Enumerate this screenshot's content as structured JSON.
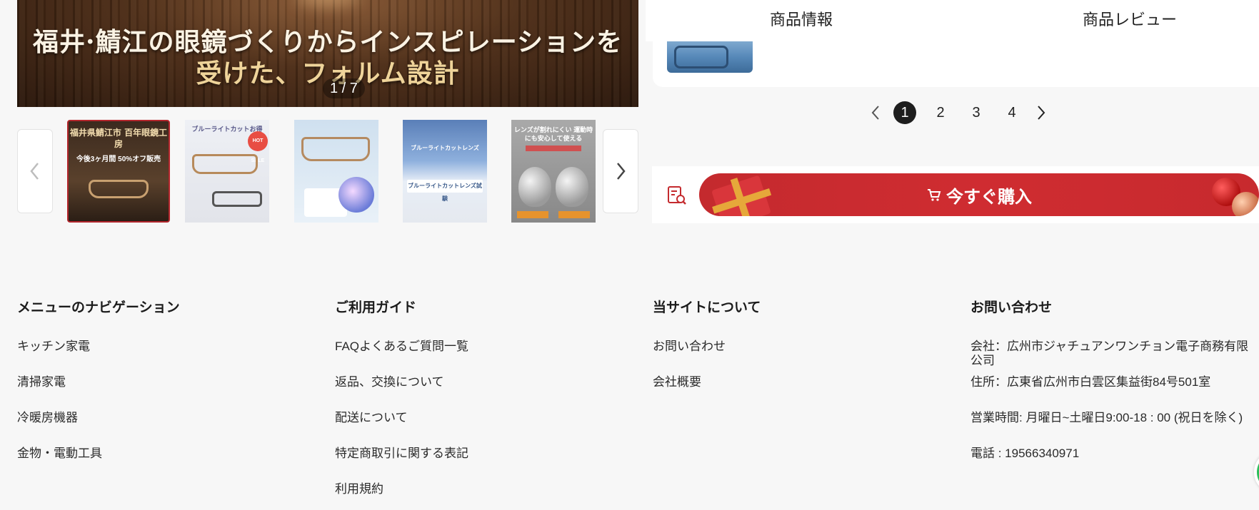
{
  "hero": {
    "line1": "福井·鯖江の眼鏡づくりからインスピレーションを",
    "line2": "受けた、フォルム設計",
    "counter": "1 / 7"
  },
  "thumbnails": {
    "t1_title": "福井県鯖江市 百年眼鏡工房",
    "t1_sub": "今後3ヶ月間 50%オフ販売",
    "t2_title": "ブルーライトカットお得",
    "t2_badge": "HOT SALE",
    "t4_title": "ブルーライトカットレンズ",
    "t4_box": "ブルーライトカットレンズ試験",
    "t5_title": "レンズが割れにくい 運動時にも安心して使える"
  },
  "tabs": {
    "info": "商品情報",
    "review": "商品レビュー"
  },
  "pagination": {
    "pages": [
      "1",
      "2",
      "3",
      "4"
    ],
    "current": "1"
  },
  "buy": {
    "label": "今すぐ購入"
  },
  "footer": {
    "nav": {
      "title": "メニューのナビゲーション",
      "items": [
        "キッチン家電",
        "清掃家電",
        "冷暖房機器",
        "金物・電動工具"
      ]
    },
    "guide": {
      "title": "ご利用ガイド",
      "items": [
        "FAQよくあるご質問一覧",
        "返品、交換について",
        "配送について",
        "特定商取引に関する表記",
        "利用規約"
      ]
    },
    "about": {
      "title": "当サイトについて",
      "items": [
        "お問い合わせ",
        "会社概要"
      ]
    },
    "contact": {
      "title": "お問い合わせ",
      "items": [
        "会社：広州市ジャチュアンワンチョン電子商務有限公司",
        "住所：広東省広州市白雲区集益街84号501室",
        "営業時間: 月曜日~土曜日9:00-18 : 00 (祝日を除く)",
        "電話 : 19566340971"
      ]
    }
  },
  "colors": {
    "buy_button": "#c42a2e",
    "active_thumb_border": "#b3262c",
    "page_current": "#1e1e1e"
  }
}
